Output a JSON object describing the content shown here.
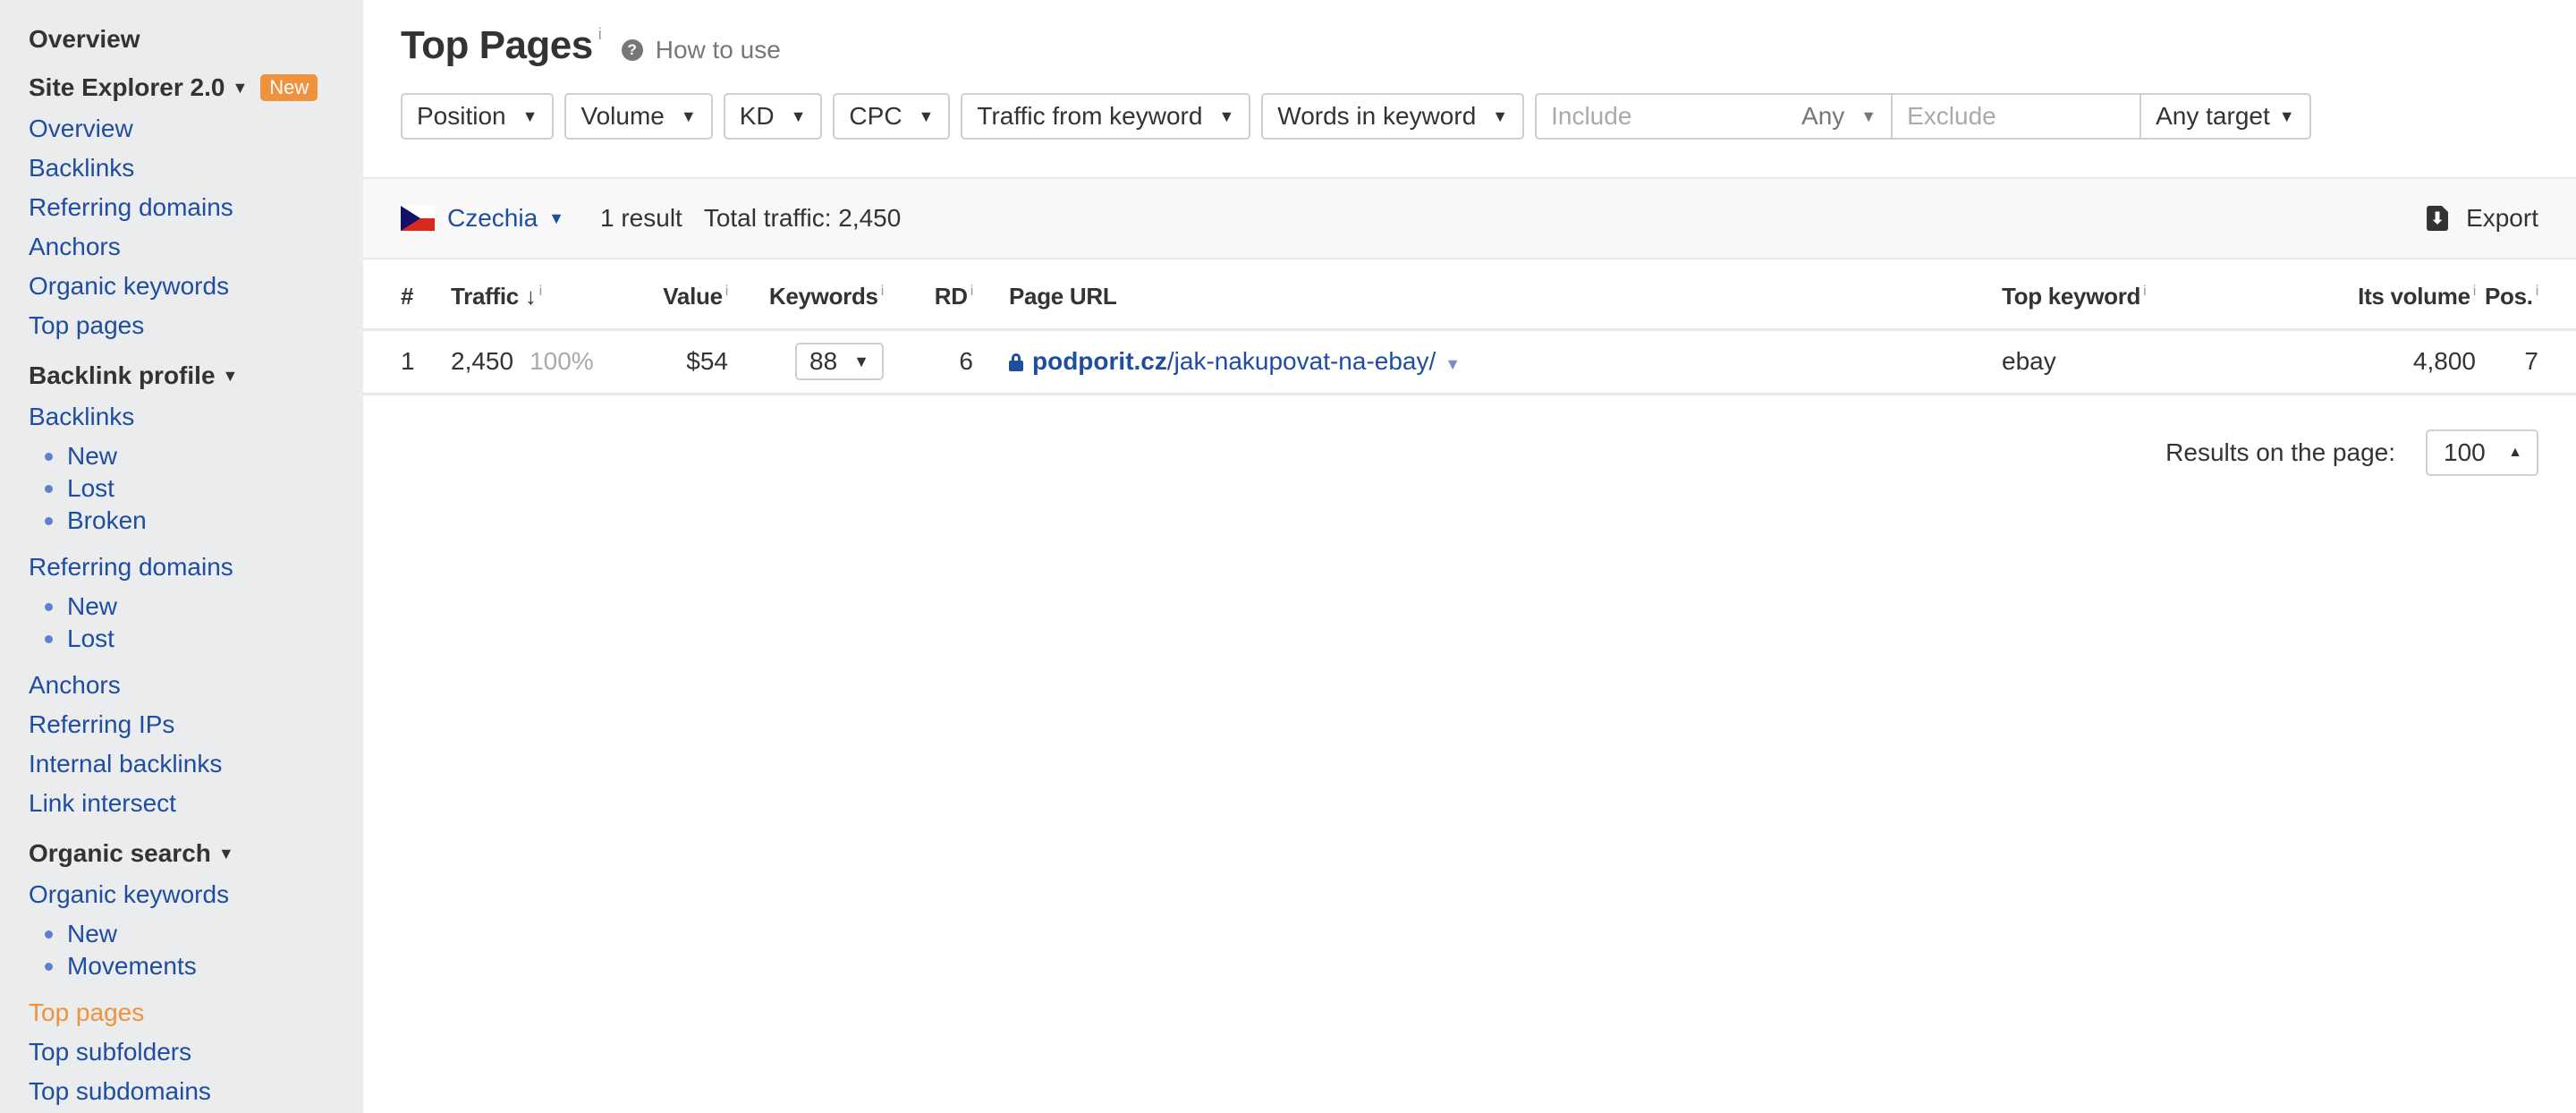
{
  "sidebar": {
    "overview_heading": "Overview",
    "site_explorer": {
      "label": "Site Explorer 2.0",
      "badge": "New",
      "caret": "▼",
      "items": [
        "Overview",
        "Backlinks",
        "Referring domains",
        "Anchors",
        "Organic keywords",
        "Top pages"
      ]
    },
    "backlink_profile": {
      "label": "Backlink profile",
      "caret": "▼",
      "backlinks": "Backlinks",
      "backlinks_sub": [
        "New",
        "Lost",
        "Broken"
      ],
      "referring_domains": "Referring domains",
      "referring_domains_sub": [
        "New",
        "Lost"
      ],
      "anchors": "Anchors",
      "referring_ips": "Referring IPs",
      "internal_backlinks": "Internal backlinks",
      "link_intersect": "Link intersect"
    },
    "organic_search": {
      "label": "Organic search",
      "caret": "▼",
      "organic_keywords": "Organic keywords",
      "organic_keywords_sub": [
        "New",
        "Movements"
      ],
      "top_pages": "Top pages",
      "top_subfolders": "Top subfolders",
      "top_subdomains": "Top subdomains"
    },
    "active_item": "Top pages"
  },
  "header": {
    "title": "Top Pages",
    "info": "i",
    "help_icon": "?",
    "how_to_use": "How to use"
  },
  "filters": {
    "dropdowns": [
      "Position",
      "Volume",
      "KD",
      "CPC",
      "Traffic from keyword",
      "Words in keyword"
    ],
    "caret": "▼",
    "include_placeholder": "Include",
    "include_mode": "Any",
    "exclude_placeholder": "Exclude",
    "target": "Any target"
  },
  "statbar": {
    "country": "Czechia",
    "caret": "▼",
    "result_count": "1 result",
    "total_traffic": "Total traffic: 2,450",
    "export_label": "Export",
    "export_icon": "⬇"
  },
  "table": {
    "columns": {
      "index": "#",
      "traffic": "Traffic",
      "sort_icon": "↓",
      "value": "Value",
      "keywords": "Keywords",
      "rd": "RD",
      "page_url": "Page URL",
      "top_keyword": "Top keyword",
      "its_volume": "Its volume",
      "pos": "Pos.",
      "info": "i"
    },
    "rows": [
      {
        "index": "1",
        "traffic": "2,450",
        "traffic_share": "100%",
        "value": "$54",
        "keywords": "88",
        "rd": "6",
        "url_host": "podporit.cz",
        "url_path": "/jak-nakupovat-na-ebay/",
        "top_keyword": "ebay",
        "its_volume": "4,800",
        "pos": "7"
      }
    ]
  },
  "pager": {
    "label": "Results on the page:",
    "value": "100",
    "caret": "▲"
  },
  "colors": {
    "link": "#1f4da0",
    "accent": "#f0913b",
    "sidebar_bg": "#ebecee"
  }
}
